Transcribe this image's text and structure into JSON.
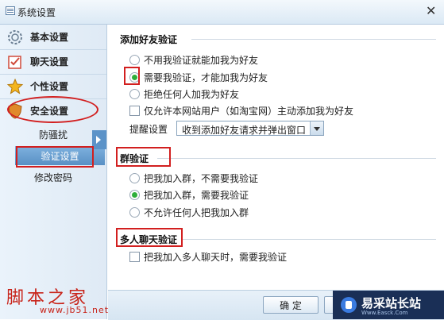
{
  "window": {
    "title": "系统设置"
  },
  "sidebar": {
    "items": [
      {
        "label": "基本设置",
        "icon": "gear-icon"
      },
      {
        "label": "聊天设置",
        "icon": "chat-checklist-icon"
      },
      {
        "label": "个性设置",
        "icon": "star-icon"
      },
      {
        "label": "安全设置",
        "icon": "shield-icon"
      }
    ],
    "sub_items": [
      {
        "label": "防骚扰"
      },
      {
        "label": "验证设置"
      },
      {
        "label": "修改密码"
      }
    ]
  },
  "friend_verify": {
    "title": "添加好友验证",
    "options": [
      {
        "label": "不用我验证就能加我为好友",
        "selected": false
      },
      {
        "label": "需要我验证，才能加我为好友",
        "selected": true
      },
      {
        "label": "拒绝任何人加我为好友",
        "selected": false
      }
    ],
    "checkbox_label": "仅允许本网站用户（如淘宝网）主动添加我为好友",
    "reminder_label": "提醒设置",
    "reminder_value": "收到添加好友请求并弹出窗口"
  },
  "group_verify": {
    "title": "群验证",
    "options": [
      {
        "label": "把我加入群，不需要我验证",
        "selected": false
      },
      {
        "label": "把我加入群，需要我验证",
        "selected": true
      },
      {
        "label": "不允许任何人把我加入群",
        "selected": false
      }
    ]
  },
  "multi_chat": {
    "title": "多人聊天验证",
    "checkbox_label": "把我加入多人聊天时，需要我验证"
  },
  "footer": {
    "ok_label": "确 定"
  },
  "watermark": {
    "left_text": "脚本之家",
    "left_url": "www.jb51.net",
    "right_text": "易采站长站",
    "right_url": "Www.Easck.Com"
  },
  "colors": {
    "highlight": "#d21f1f",
    "selected_radio": "#2fae3a",
    "active_sub_bg": "#6aa0d2"
  }
}
